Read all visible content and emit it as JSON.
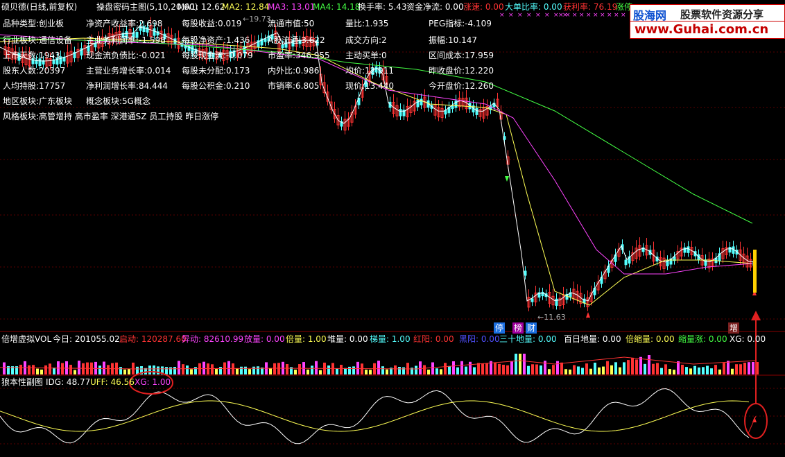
{
  "header": {
    "title": "硕贝德(日线,前复权)",
    "indicator_name": "操盘密码主图(5,10,20,60)",
    "ma1": "MA1: 12.62",
    "ma2": "MA2: 12.84",
    "ma3": "MA3: 13.01",
    "ma4": "MA4: 14.18",
    "turnover": "换手率: 5.43",
    "net_flow": "资金净流: 0.00",
    "speed": "涨速: 0.00",
    "big_order": "大单比率: 0.00",
    "profit": "获利率: 76.19",
    "limit": "涨停"
  },
  "logo": {
    "name": "股海网",
    "slogan": "股票软件资源分享",
    "url": "www.Guhai.com.cn"
  },
  "colors": {
    "ma1": "#ffffff",
    "ma2": "#ffff55",
    "ma3": "#ff44ff",
    "ma4": "#44ff44",
    "up": "#ff3333",
    "down": "#54ffff",
    "highlight": "#e02020"
  },
  "info": [
    {
      "label": "品种类型:",
      "value": "创业板"
    },
    {
      "label": "行业板块:",
      "value": "通信设备"
    },
    {
      "label": "上市天数:",
      "value": "1943"
    },
    {
      "label": "股东人数:",
      "value": "20397"
    },
    {
      "label": "人均持股:",
      "value": "17757"
    },
    {
      "label": "地区板块:",
      "value": "广东板块"
    },
    {
      "label": "风格板块:",
      "value": "高管增持 高市盈率 深港通SZ 员工持股 昨日涨停"
    },
    {
      "label": "净资产收益率:",
      "value": "2.698"
    },
    {
      "label": "主业务利润率:",
      "value": "-1.598"
    },
    {
      "label": "现金流负债比:",
      "value": "-0.021"
    },
    {
      "label": "主营业务增长率:",
      "value": "0.014"
    },
    {
      "label": "净利润增长率:",
      "value": "84.444"
    },
    {
      "label": "概念板块:",
      "value": "5G概念"
    },
    {
      "label": "每股收益:",
      "value": "0.019"
    },
    {
      "label": "每股净资产:",
      "value": "1.436"
    },
    {
      "label": "每股现金流:",
      "value": "-0.079"
    },
    {
      "label": "每股未分配:",
      "value": "0.173"
    },
    {
      "label": "每股公积金:",
      "value": "0.210"
    },
    {
      "label": "流通市值:",
      "value": "50"
    },
    {
      "label": "A股流通:",
      "value": "3.622"
    },
    {
      "label": "市盈率:",
      "value": "346.955"
    },
    {
      "label": "内外比:",
      "value": "0.986"
    },
    {
      "label": "市销率:",
      "value": "6.805"
    },
    {
      "label": "量比:",
      "value": "1.935"
    },
    {
      "label": "成交方向:",
      "value": "2"
    },
    {
      "label": "主动买单:",
      "value": "0"
    },
    {
      "label": "均价:",
      "value": "12.911"
    },
    {
      "label": "现价:",
      "value": "13.440"
    },
    {
      "label": "PEG指标:",
      "value": "-4.109"
    },
    {
      "label": "振幅:",
      "value": "10.147"
    },
    {
      "label": "区间成本:",
      "value": "17.959"
    },
    {
      "label": "昨收盘价:",
      "value": "12.220"
    },
    {
      "label": "今开盘价:",
      "value": "12.260"
    }
  ],
  "price_labels": {
    "high": "19.73",
    "low": "11.63"
  },
  "markers": {
    "ting": "停",
    "bang": "榜",
    "cai": "财",
    "zeng": "增",
    "up_arrow": "增"
  },
  "volume": {
    "name": "倍增虚拟VOL",
    "today": "今日: 201055.02",
    "qidong": "启动: 120287.60",
    "yidong": "异动: 82610.99",
    "fangliang": "放量: 0.00",
    "beiliang": "倍量: 1.00",
    "duiliang": "堆量: 0.00",
    "tiliang": "梯量: 1.00",
    "hongyang": "红阳: 0.00",
    "heiyang": "黑阳: 0.00",
    "sanshi": "三十地量: 0.00",
    "baiyi": "百日地量: 0.00",
    "beisuo": "倍缩量: 0.00",
    "suoliang": "缩量涨: 0.00",
    "xg": "XG: 0.00"
  },
  "sub": {
    "name": "狼本性副图",
    "idg": "IDG: 48.77",
    "uff": "UFF: 46.56",
    "xg": "XG: 1.00"
  }
}
